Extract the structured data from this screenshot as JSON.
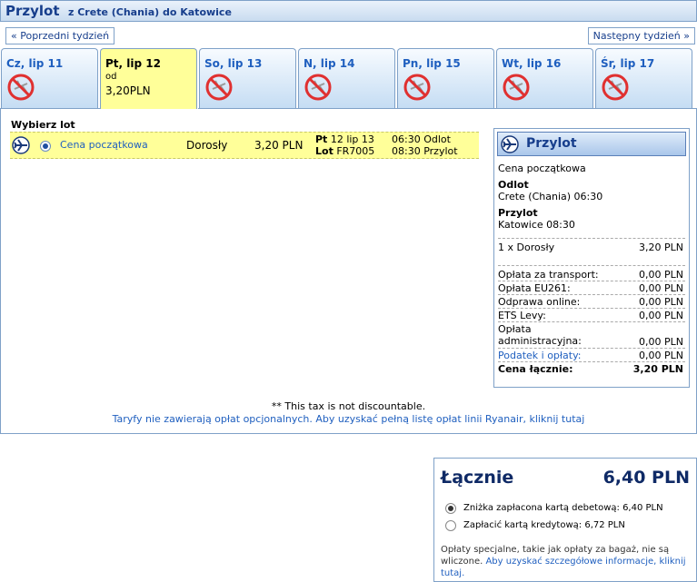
{
  "header": {
    "title": "Przylot",
    "route": "z Crete (Chania) do Katowice"
  },
  "nav": {
    "prev_week": "« Poprzedni tydzień",
    "next_week": "Następny tydzień »"
  },
  "tabs": [
    {
      "day": "Cz, lip 11",
      "available": false
    },
    {
      "day": "Pt, lip 12",
      "available": true,
      "from_label": "od",
      "price": "3,20PLN"
    },
    {
      "day": "So, lip 13",
      "available": false
    },
    {
      "day": "N, lip 14",
      "available": false
    },
    {
      "day": "Pn, lip 15",
      "available": false
    },
    {
      "day": "Wt, lip 16",
      "available": false
    },
    {
      "day": "Śr, lip 17",
      "available": false
    }
  ],
  "select_flight": {
    "heading": "Wybierz lot",
    "fare_name": "Cena początkowa",
    "passenger": "Dorosły",
    "price": "3,20 PLN",
    "day_label": "Pt",
    "date": "12 lip 13",
    "flight_label": "Lot",
    "flight_no": "FR7005",
    "depart_time": "06:30",
    "depart_label": "Odlot",
    "arrive_time": "08:30",
    "arrive_label": "Przylot"
  },
  "summary": {
    "title": "Przylot",
    "fare": "Cena początkowa",
    "depart_heading": "Odlot",
    "depart_detail": "Crete (Chania) 06:30",
    "arrive_heading": "Przylot",
    "arrive_detail": "Katowice 08:30",
    "passenger_line": "1 x Dorosły",
    "passenger_price": "3,20 PLN",
    "fees": [
      {
        "label": "Opłata za transport:",
        "value": "0,00 PLN"
      },
      {
        "label": "Opłata EU261:",
        "value": "0,00 PLN"
      },
      {
        "label": "Odprawa online:",
        "value": "0,00 PLN"
      },
      {
        "label": "ETS Levy:",
        "value": "0,00 PLN"
      },
      {
        "label": "Opłata administracyjna:",
        "value": "0,00 PLN"
      },
      {
        "label": "Podatek i opłaty:",
        "value": "0,00 PLN"
      }
    ],
    "total_label": "Cena łącznie:",
    "total_value": "3,20 PLN"
  },
  "footer": {
    "tax_note": "** This tax is not discountable.",
    "fees_link": "Taryfy nie zawierają opłat opcjonalnych. Aby uzyskać pełną listę opłat linii Ryanair, kliknij tutaj"
  },
  "total_box": {
    "label": "Łącznie",
    "amount": "6,40 PLN",
    "options": [
      {
        "text": "Zniżka zapłacona kartą debetową: 6,40 PLN",
        "selected": true
      },
      {
        "text": "Zapłacić kartą kredytową: 6,72 PLN",
        "selected": false
      }
    ],
    "note": "Opłaty specjalne, takie jak opłaty za bagaż, nie są wliczone.",
    "note_link": "Aby uzyskać szczegółowe informacje, kliknij tutaj."
  },
  "colors": {
    "accent": "#173e8c",
    "link": "#1f5fbf",
    "highlight": "#ffff99",
    "no_flight": "#e03030"
  }
}
